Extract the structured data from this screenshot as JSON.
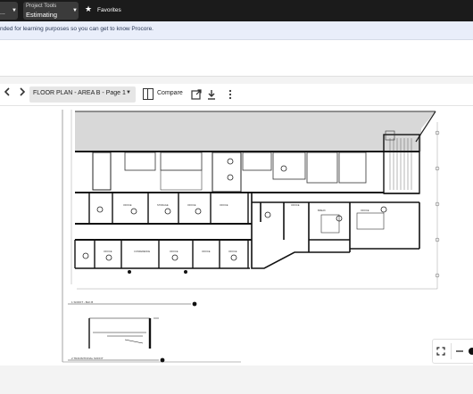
{
  "topbar": {
    "company_selector": {
      "value": "..."
    },
    "project_tools": {
      "label": "Project Tools",
      "value": "Estimating"
    },
    "favorites_label": "Favorites"
  },
  "banner": {
    "text": "nded for learning purposes so you can get to know Procore."
  },
  "viewer_toolbar": {
    "prev_icon": "chevron-left-icon",
    "next_icon": "chevron-right-icon",
    "page_selector": "FLOOR PLAN - AREA B - Page 1",
    "compare_label": "Compare",
    "icons": [
      "open-external-icon",
      "download-icon",
      "more-vertical-icon"
    ]
  },
  "drawing": {
    "room_labels": [
      "OFFICE",
      "STORAGE",
      "OFFICE",
      "OFFICE",
      "OFFICE",
      "CONFERENCE",
      "OFFICE",
      "OFFICE",
      "OFFICE",
      "OFFICE",
      "BREAK",
      "OFFICE"
    ],
    "detail_titles": [
      "1  SOFFIT - BLK B",
      "2  TRANSITIONAL SOFFIT"
    ]
  },
  "zoom_controls": {
    "icons": [
      "fit-screen-icon",
      "zoom-out-icon",
      "zoom-slider-handle"
    ]
  },
  "colors": {
    "topbar": "#1b1b1b",
    "banner": "#e9eefa",
    "accent": "#2b3a57"
  }
}
